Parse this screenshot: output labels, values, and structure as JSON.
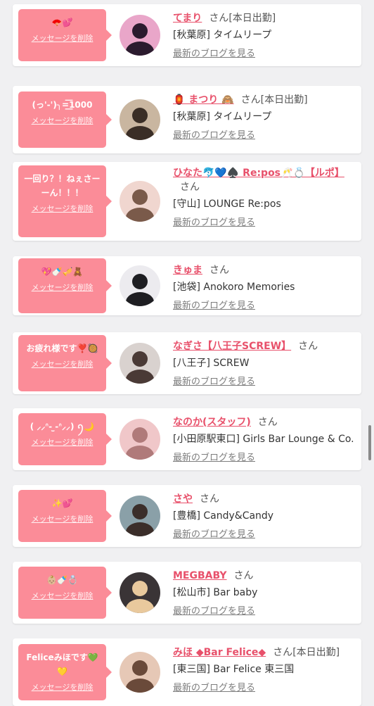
{
  "delete_label": "メッセージを削除",
  "blog_label": "最新のブログを見る",
  "honorific": "さん",
  "accent_color": "#fb8c98",
  "name_color": "#e8516b",
  "messages": [
    {
      "message": "🪭💕",
      "name": "てまり",
      "status": "[本日出勤]",
      "shop": "[秋葉原] タイムリープ",
      "avatar_colors": [
        "#e9a6c9",
        "#2b1b2e"
      ]
    },
    {
      "message": "(っ'-')╮=͟͟͞͞1000",
      "name": "🏮 まつり 🙈",
      "status": "[本日出勤]",
      "shop": "[秋葉原] タイムリープ",
      "avatar_colors": [
        "#c9b6a0",
        "#3a2e26"
      ]
    },
    {
      "message": "一回り？！ねぇさーーん！！！",
      "name": "ひなた🐬💙♠️ Re:pos🥂💍【ルポ】",
      "status": "",
      "shop": "[守山] LOUNGE Re:pos",
      "avatar_colors": [
        "#f0d6cf",
        "#7a5a4a"
      ]
    },
    {
      "message": "💖🍼🎺🧸",
      "name": "きゅま",
      "status": "",
      "shop": "[池袋] Anokoro Memories",
      "avatar_colors": [
        "#ecebef",
        "#1e1e22"
      ]
    },
    {
      "message": "お疲れ様です❣️🥘",
      "name": "なぎさ【八王子SCREW】",
      "status": "",
      "shop": "[八王子] SCREW",
      "avatar_colors": [
        "#d9d2cf",
        "#4a3a36"
      ]
    },
    {
      "message": "( ⸝⸝ᐢ- ̫-ᐢ⸝⸝) ꪆ🌙",
      "name": "なのか(スタッフ)",
      "status": "",
      "shop": "[小田原駅東口] Girls Bar Lounge & Co.",
      "avatar_colors": [
        "#f0c7c9",
        "#b07a7a"
      ]
    },
    {
      "message": "✨💕",
      "name": "さや",
      "status": "",
      "shop": "[豊橋] Candy&Candy",
      "avatar_colors": [
        "#8aa0a8",
        "#3b2e2a"
      ]
    },
    {
      "message": "👶🏼🍼💍",
      "name": "MEGBABY",
      "status": "",
      "shop": "[松山市] Bar baby",
      "avatar_colors": [
        "#3a3436",
        "#e9c99d"
      ]
    },
    {
      "message": "Feliceみほです💚💛",
      "name": "みほ ◆Bar Felice◆",
      "status": "[本日出勤]",
      "shop": "[東三国] Bar Felice 東三国",
      "avatar_colors": [
        "#e6c8b6",
        "#6a4a3a"
      ]
    }
  ]
}
